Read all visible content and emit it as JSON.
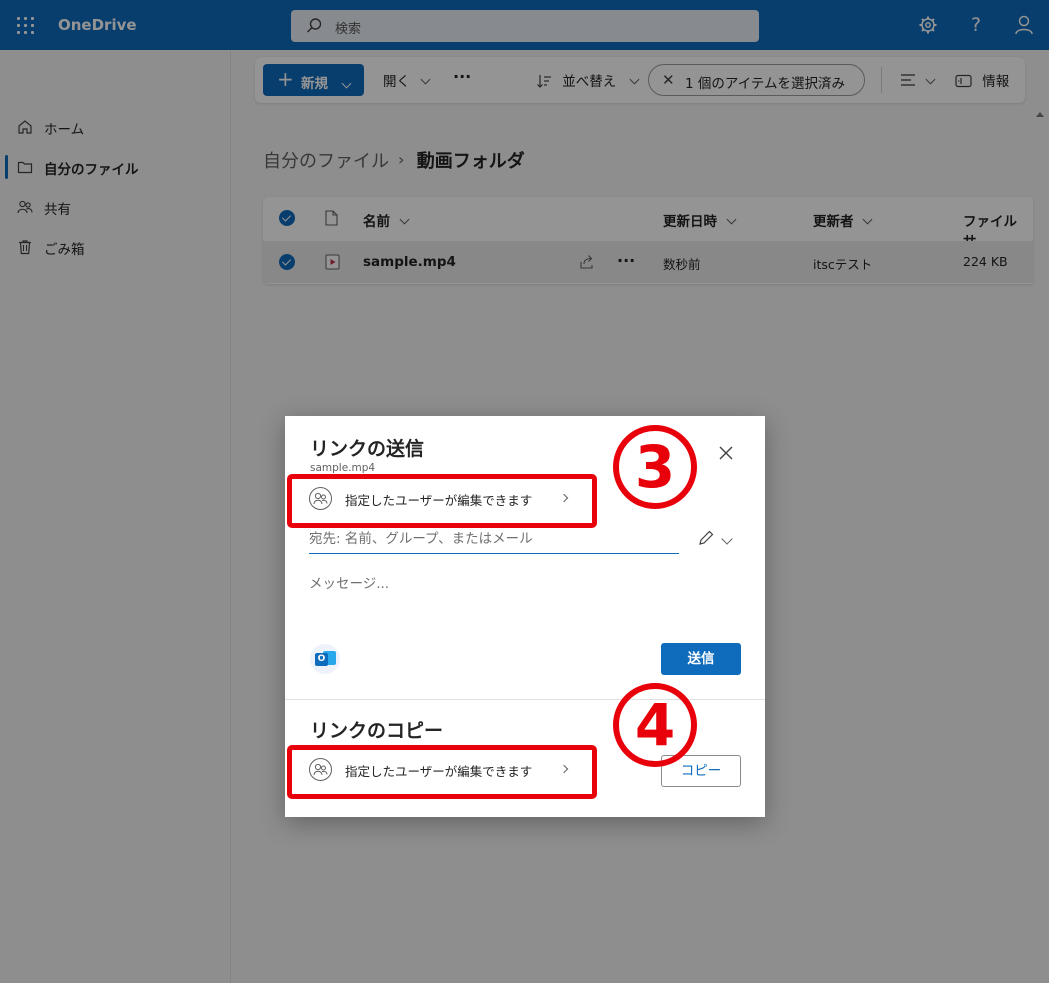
{
  "app": {
    "brand": "OneDrive"
  },
  "search": {
    "placeholder": "検索"
  },
  "nav": {
    "items": [
      {
        "label": "ホーム",
        "icon": "home-icon",
        "active": false
      },
      {
        "label": "自分のファイル",
        "icon": "folder-icon",
        "active": true
      },
      {
        "label": "共有",
        "icon": "people-icon",
        "active": false
      },
      {
        "label": "ごみ箱",
        "icon": "trash-icon",
        "active": false
      }
    ]
  },
  "toolbar": {
    "new_label": "新規",
    "open_label": "開く",
    "more_label": "···",
    "sort_label": "並べ替え",
    "selected_label": "1 個のアイテムを選択済み",
    "view_label": "",
    "info_label": "情報"
  },
  "breadcrumb": {
    "parent": "自分のファイル",
    "current": "動画フォルダ"
  },
  "file_list": {
    "columns": [
      "名前",
      "更新日時",
      "更新者",
      "ファイル サ"
    ],
    "rows": [
      {
        "name": "sample.mp4",
        "modified": "数秒前",
        "modified_by": "itscテスト",
        "size": "224 KB"
      }
    ]
  },
  "dialog": {
    "send_title": "リンクの送信",
    "file_name": "sample.mp4",
    "permission_label": "指定したユーザーが編集できます",
    "to_placeholder": "宛先: 名前、グループ、またはメール",
    "message_placeholder": "メッセージ...",
    "send_button": "送信",
    "copy_title": "リンクのコピー",
    "copy_permission_label": "指定したユーザーが編集できます",
    "copy_button": "コピー"
  },
  "annotations": {
    "step_a": "3",
    "step_b": "4",
    "color": "#e8000a"
  },
  "colors": {
    "accent": "#0f6cbd",
    "topbar": "#0f6cbd"
  }
}
